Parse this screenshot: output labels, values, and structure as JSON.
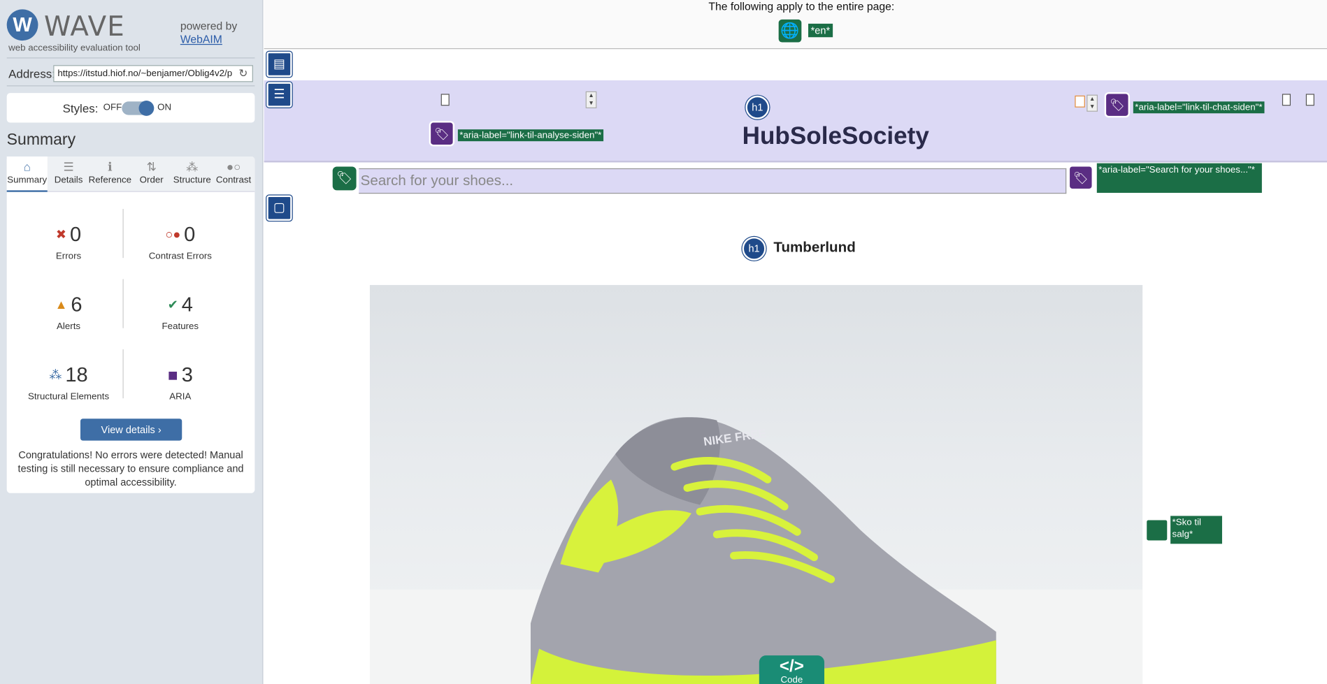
{
  "sidebar": {
    "logo_letter": "W",
    "logo_text": "WAVE",
    "logo_subtitle": "web accessibility evaluation tool",
    "powered_by": "powered by",
    "powered_link": "WebAIM",
    "address_label": "Address:",
    "address_value": "https://itstud.hiof.no/~benjamer/Oblig4v2/p",
    "styles_label": "Styles:",
    "styles_off": "OFF",
    "styles_on": "ON",
    "summary_title": "Summary",
    "tabs": [
      {
        "label": "Summary",
        "icon": "home-icon",
        "glyph": "⌂"
      },
      {
        "label": "Details",
        "icon": "list-icon",
        "glyph": "☰"
      },
      {
        "label": "Reference",
        "icon": "info-icon",
        "glyph": "ℹ"
      },
      {
        "label": "Order",
        "icon": "order-icon",
        "glyph": "⇅"
      },
      {
        "label": "Structure",
        "icon": "structure-icon",
        "glyph": "⁂"
      },
      {
        "label": "Contrast",
        "icon": "contrast-icon",
        "glyph": "●○"
      }
    ],
    "stats": {
      "errors": {
        "value": "0",
        "label": "Errors",
        "glyph": "✖",
        "color": "#c0392b"
      },
      "contrast_errors": {
        "value": "0",
        "label": "Contrast Errors",
        "glyph": "○●",
        "color": "#c0392b"
      },
      "alerts": {
        "value": "6",
        "label": "Alerts",
        "glyph": "▲",
        "color": "#d98a1a"
      },
      "features": {
        "value": "4",
        "label": "Features",
        "glyph": "✔",
        "color": "#2e8b57"
      },
      "structural": {
        "value": "18",
        "label": "Structural Elements",
        "glyph": "⁂",
        "color": "#3e6ea6"
      },
      "aria": {
        "value": "3",
        "label": "ARIA",
        "glyph": "◼",
        "color": "#5a2d83"
      }
    },
    "view_details": "View details ›",
    "congrats": "Congratulations! No errors were detected! Manual testing is still necessary to ensure compliance and optimal accessibility."
  },
  "main": {
    "page_note": "The following apply to the entire page:",
    "lang_tag": "*en*",
    "aria_analyse": "*aria-label=\"link-til-analyse-siden\"*",
    "h1_badge": "h1",
    "site_title": "HubSoleSociety",
    "aria_chat": "*aria-label=\"link-til-chat-siden\"*",
    "search_placeholder": "Search for your shoes...",
    "aria_search": "*aria-label=\"Search for your shoes...\"*",
    "product_title": "Tumberlund",
    "img_alt": "*Sko til salg*",
    "code_symbol": "</>",
    "code_label": "Code",
    "shoe_brand": "NIKE FREE"
  },
  "colors": {
    "wave_blue": "#3e6ea6",
    "feature_green": "#1b6e46",
    "aria_purple": "#5a2d83",
    "structure_navy": "#1f4a8a",
    "header_lavender": "#dcd9f5"
  }
}
